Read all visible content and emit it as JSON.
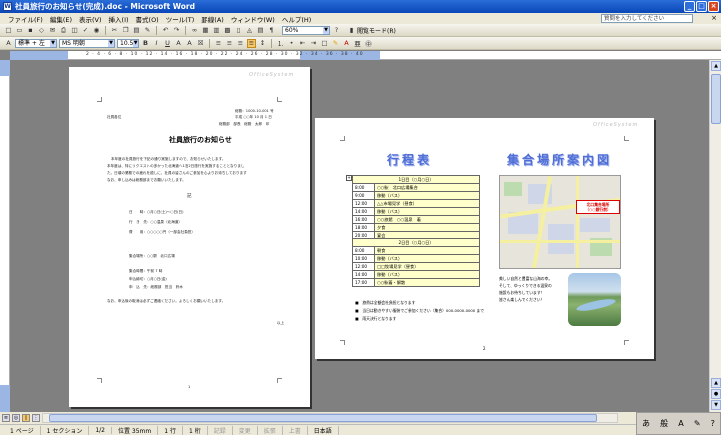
{
  "window": {
    "title": "社員旅行のお知らせ(完成).doc - Microsoft Word"
  },
  "menu": [
    "ファイル(F)",
    "編集(E)",
    "表示(V)",
    "挿入(I)",
    "書式(O)",
    "ツール(T)",
    "罫線(A)",
    "ウィンドウ(W)",
    "ヘルプ(H)"
  ],
  "help_placeholder": "質問を入力してください",
  "toolbar": {
    "zoom": "60%",
    "read_mode": "閲覧モード(R)",
    "style": "標準 + 左",
    "font": "MS 明朝",
    "size": "10.5"
  },
  "page1": {
    "date_line": "平成 ○○年 10 月 1 日",
    "doc_no": "総務：1000-10-001 号",
    "to": "社員各位",
    "from": "総務部　部長　総務　太郎　印",
    "title": "社員旅行のお知らせ",
    "body": [
      "本年度の社員旅行を下記の通り実施しますので、お知らせいたします。",
      "本年度は、特にリクエストの多かった北海道へ1泊2日旅行を実施することとなりまし",
      "た。日頃の業務での疲れを癒しに、社員の皆さんのご参加を心よりお待ちしております",
      "なお、申し込みは総務部までお願いいたします。"
    ],
    "ki": "記",
    "items": [
      "日　　時：○月○日(土)〜○日(日)",
      "行　き　先：○○温泉（北海道）",
      "費　　用：○○○○○円（一部会社負担）",
      "集合場所：○○駅　北口広場",
      "集合時間：午前 7 時",
      "申込締切：○月○日(金)",
      "申　込　先：総務部　担当　鈴木"
    ],
    "closing": "なお、申込後の取消は必ずご連絡ください。よろしくお願いいたします。",
    "ijo": "以上",
    "page_no": "1"
  },
  "page2": {
    "title_left": "行程表",
    "title_right": "集合場所案内図",
    "day1_header": "1日目（○月○日）",
    "day1": [
      [
        "8:00",
        "○○駅　北口広場集合"
      ],
      [
        "9:00",
        "移動（バス）"
      ],
      [
        "12:00",
        "△△市場見学（昼食）"
      ],
      [
        "14:00",
        "移動（バス）"
      ],
      [
        "16:00",
        "○○旅館　○○温泉　着"
      ],
      [
        "18:00",
        "夕食"
      ],
      [
        "20:00",
        "宴会"
      ]
    ],
    "day2_header": "2日目（○月○日）",
    "day2": [
      [
        "8:00",
        "朝食"
      ],
      [
        "10:00",
        "移動（バス）"
      ],
      [
        "12:00",
        "□□牧場見学（昼食）"
      ],
      [
        "14:00",
        "移動（バス）"
      ],
      [
        "17:00",
        "○○駅着・解散"
      ]
    ],
    "callout": [
      "北口集合場所",
      "（○○銀行前）"
    ],
    "side_text": [
      "美しい自然と豊富な山海の幸。",
      "そして、ゆっくりできる温泉の",
      "施設もお待ちしています！",
      "皆さん楽しんでください！"
    ],
    "notes": [
      "■　旅費は全額会社負担となります",
      "■　当日は動きやすい服装でご参加ください（集合）000-0000-0000 まで",
      "■　雨天決行となります"
    ],
    "page_no": "2"
  },
  "status": {
    "page": "1 ページ",
    "section": "1 セクション",
    "pages": "1/2",
    "position": "位置 35mm",
    "line": "1 行",
    "col": "1 桁",
    "rec": "記録",
    "trk": "変更",
    "ext": "拡張",
    "ovr": "上書",
    "lang": "日本語"
  },
  "ime": {
    "mode": "あ",
    "kanji": "般",
    "a": "A"
  }
}
